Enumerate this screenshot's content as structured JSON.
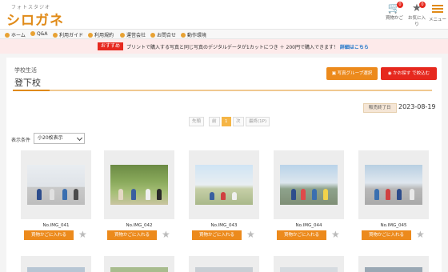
{
  "header": {
    "logo_sub": "フォトスタジオ",
    "logo_main": "シロガネ",
    "icons": [
      {
        "name": "cart-icon",
        "label": "買物かご",
        "badge": "0"
      },
      {
        "name": "star-icon",
        "label": "お気に入り",
        "badge": "0"
      },
      {
        "name": "menu-icon",
        "label": "メニュー"
      }
    ]
  },
  "nav": {
    "items": [
      "ホーム",
      "Q&A",
      "利用ガイド",
      "利用規約",
      "運営会社",
      "お問合せ",
      "動作環境"
    ]
  },
  "promo": {
    "tag": "おすすめ",
    "text": "プリントで購入する写真と同じ写真のデジタルデータが1カットにつき ＋ 200円で購入できます！",
    "link": "詳細はこちら"
  },
  "page": {
    "breadcrumb": "学校生活",
    "school": "登下校",
    "group_button": "写真グループ選択",
    "apply_button": "かお探す で絞込む",
    "end_label": "販売終了日",
    "end_date": "2023-08-19"
  },
  "pager": [
    "先頭",
    "前",
    "1",
    "次",
    "最終(1P)"
  ],
  "display": {
    "label": "表示条件",
    "selected": "小20枚表示"
  },
  "items": [
    {
      "no": "No.IMG_041",
      "cart": "買物かごに入れる"
    },
    {
      "no": "No.IMG_042",
      "cart": "買物かごに入れる"
    },
    {
      "no": "No.IMG_043",
      "cart": "買物かごに入れる"
    },
    {
      "no": "No.IMG_044",
      "cart": "買物かごに入れる"
    },
    {
      "no": "No.IMG_045",
      "cart": "買物かごに入れる"
    }
  ],
  "colors": {
    "accent": "#e08a17",
    "cart_button": "#ec8a1c",
    "apply_button": "#e6281e",
    "promo_bg": "#fdeaea",
    "link": "#1a73c8"
  }
}
